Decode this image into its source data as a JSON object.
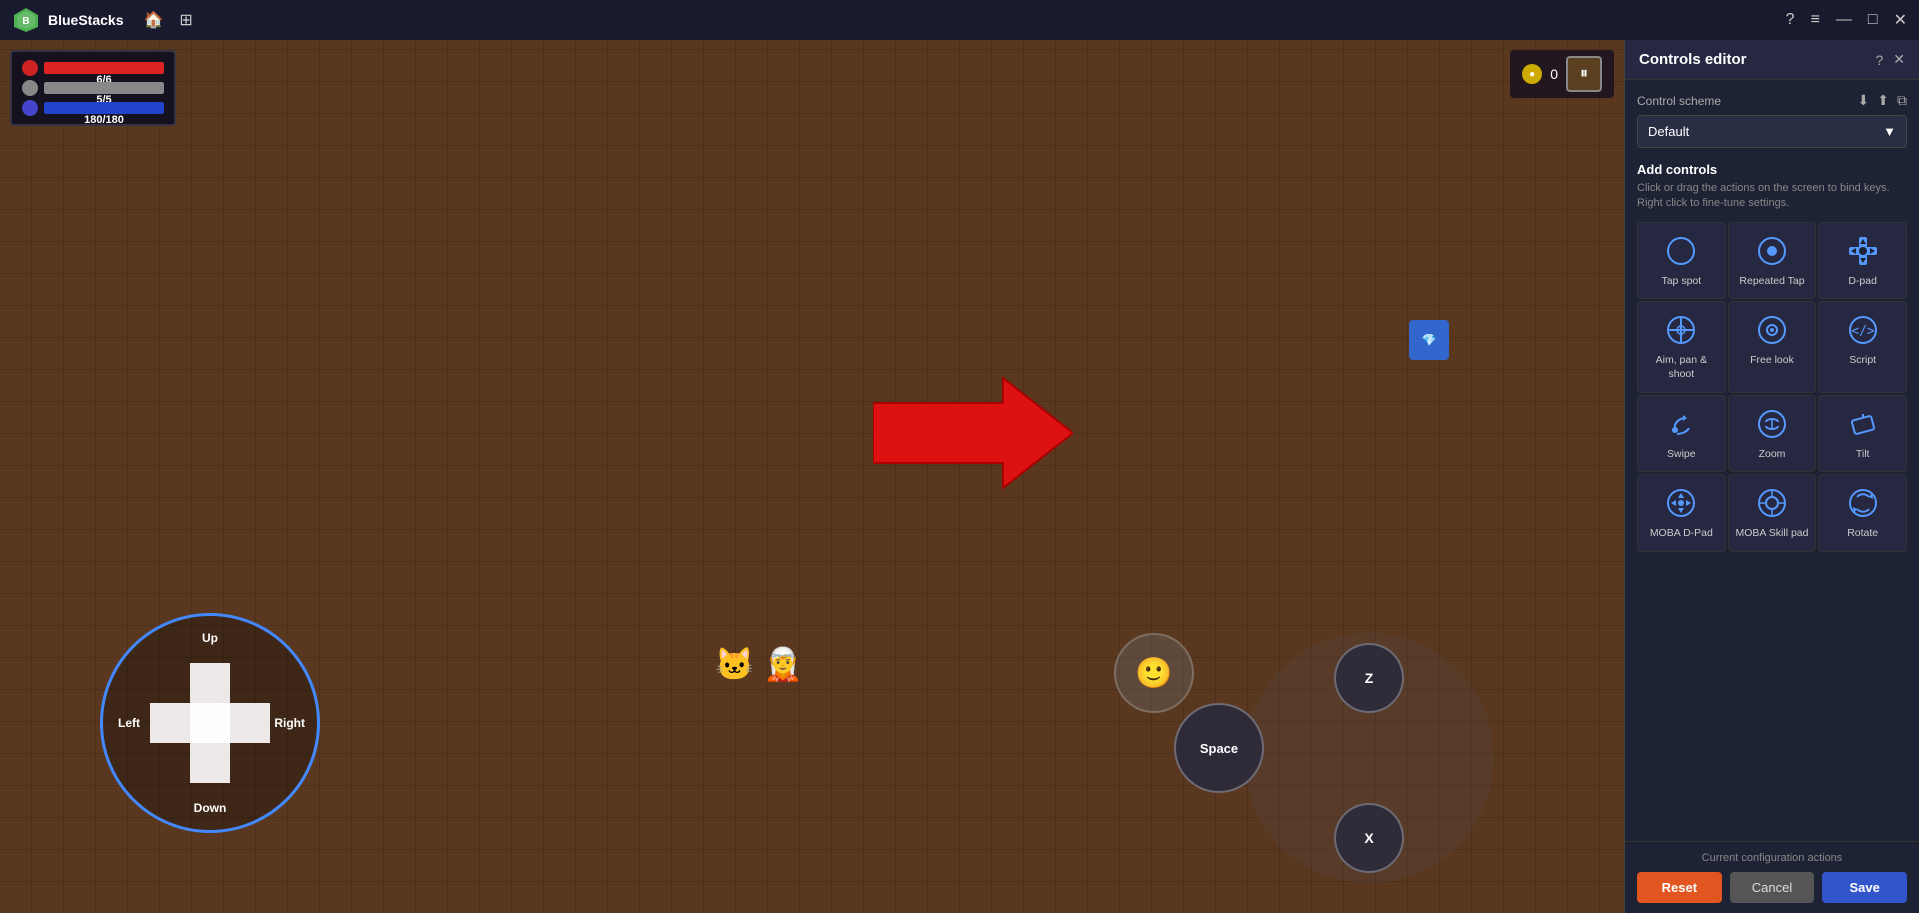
{
  "titlebar": {
    "app_name": "BlueStacks",
    "home_icon": "🏠",
    "layout_icon": "⊞",
    "help_icon": "?",
    "menu_icon": "≡",
    "minimize_icon": "—",
    "maximize_icon": "□",
    "close_icon": "✕"
  },
  "hud": {
    "hp": "6/6",
    "shield": "5/5",
    "mana": "180/180",
    "coins": "0"
  },
  "dpad": {
    "up": "Up",
    "down": "Down",
    "left": "Left",
    "right": "Right"
  },
  "action_buttons": {
    "z": "Z",
    "x": "X",
    "space": "Space"
  },
  "panel": {
    "title": "Controls editor",
    "help_icon": "?",
    "close_icon": "✕",
    "scheme_label": "Control scheme",
    "scheme_value": "Default",
    "add_controls_title": "Add controls",
    "add_controls_desc": "Click or drag the actions on the screen to bind keys. Right click to fine-tune settings.",
    "controls": [
      {
        "id": "tap-spot",
        "label": "Tap spot",
        "icon_type": "circle"
      },
      {
        "id": "repeated-tap",
        "label": "Repeated Tap",
        "icon_type": "circle-dots"
      },
      {
        "id": "d-pad",
        "label": "D-pad",
        "icon_type": "dpad"
      },
      {
        "id": "aim-pan-shoot",
        "label": "Aim, pan & shoot",
        "icon_type": "crosshair"
      },
      {
        "id": "free-look",
        "label": "Free look",
        "icon_type": "eye-circle"
      },
      {
        "id": "script",
        "label": "Script",
        "icon_type": "code"
      },
      {
        "id": "swipe",
        "label": "Swipe",
        "icon_type": "swipe"
      },
      {
        "id": "zoom",
        "label": "Zoom",
        "icon_type": "zoom"
      },
      {
        "id": "tilt",
        "label": "Tilt",
        "icon_type": "tilt"
      },
      {
        "id": "moba-dpad",
        "label": "MOBA D-Pad",
        "icon_type": "moba-dpad"
      },
      {
        "id": "moba-skill",
        "label": "MOBA Skill pad",
        "icon_type": "moba-skill"
      },
      {
        "id": "rotate",
        "label": "Rotate",
        "icon_type": "rotate"
      }
    ],
    "current_config_label": "Current configuration actions",
    "btn_reset": "Reset",
    "btn_cancel": "Cancel",
    "btn_save": "Save"
  }
}
